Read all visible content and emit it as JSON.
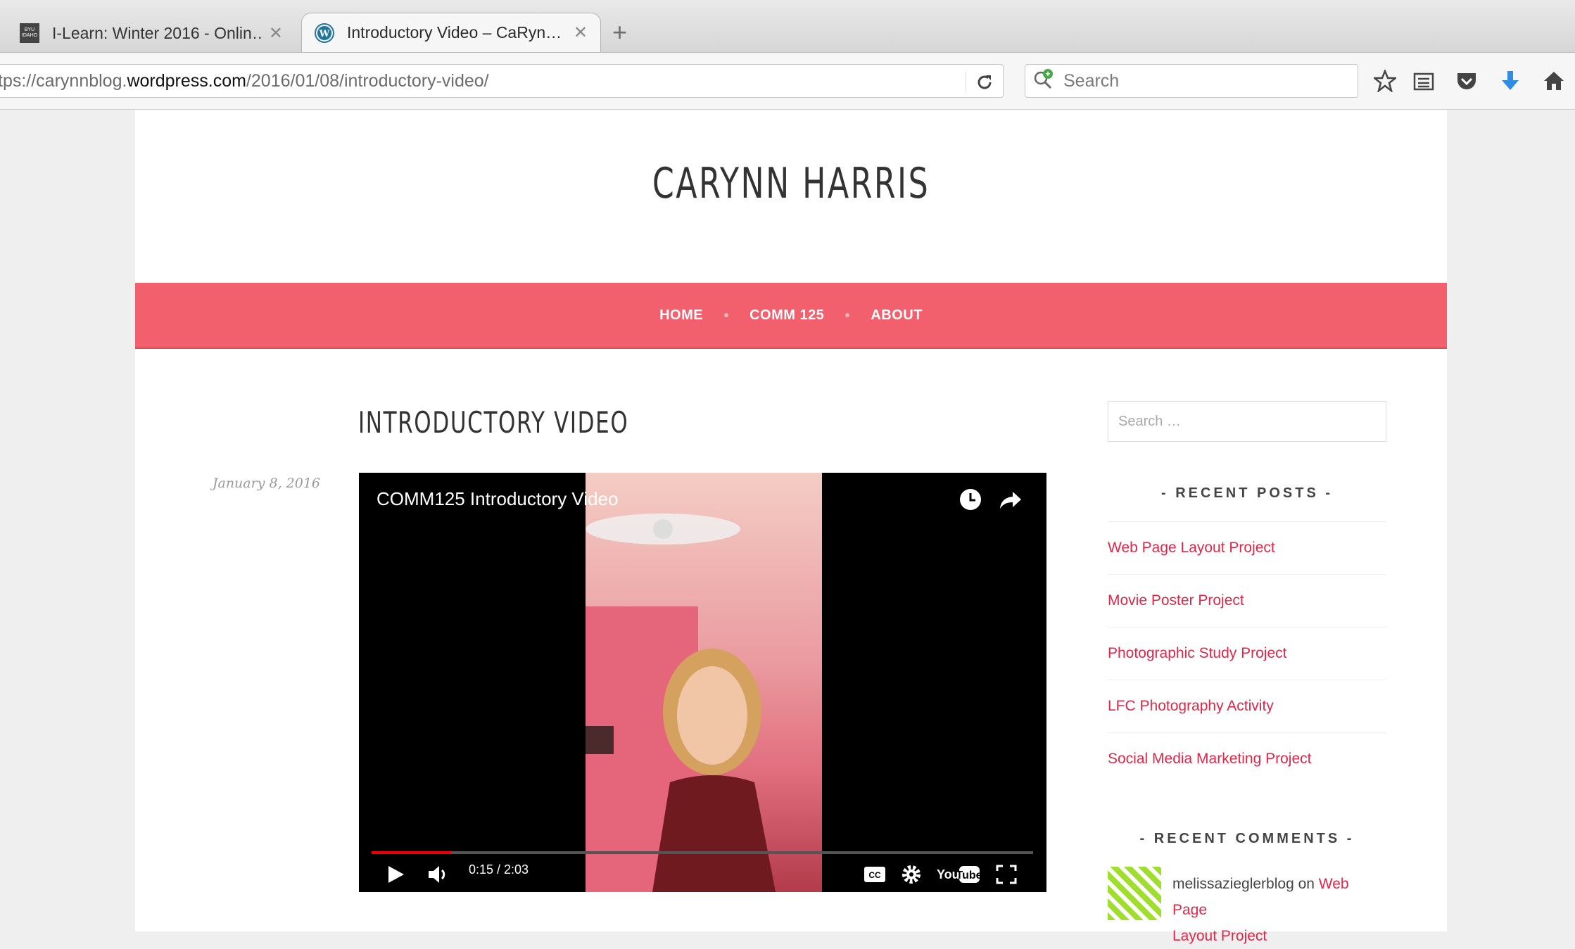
{
  "browser": {
    "tabs": [
      {
        "title": "I-Learn: Winter 2016 - Onlin…",
        "favicon": "BYU IDAHO",
        "active": false
      },
      {
        "title": "Introductory Video – CaRyn…",
        "active": true
      }
    ],
    "url_prefix": "tps://carynnblog.",
    "url_domain": "wordpress.com",
    "url_path": "/2016/01/08/introductory-video/",
    "search_placeholder": "Search"
  },
  "site": {
    "title": "CARYNN HARRIS",
    "nav": [
      "HOME",
      "COMM 125",
      "ABOUT"
    ],
    "accent": "#f2606e",
    "link_color": "#e0274a"
  },
  "post": {
    "title": "INTRODUCTORY VIDEO",
    "date": "January 8, 2016",
    "video": {
      "title": "COMM125 Introductory Video",
      "time": "0:15 / 2:03",
      "progress_percent": 12
    }
  },
  "sidebar": {
    "search_placeholder": "Search …",
    "recent_posts_heading": "- RECENT POSTS -",
    "recent_posts": [
      "Web Page Layout Project",
      "Movie Poster Project",
      "Photographic Study Project",
      "LFC Photography Activity",
      "Social Media Marketing Project"
    ],
    "recent_comments_heading": "- RECENT COMMENTS -",
    "comment": {
      "author": "melissazieglerblog",
      "on": "on",
      "post_line1": "Web Page",
      "post_line2": "Layout Project"
    }
  }
}
